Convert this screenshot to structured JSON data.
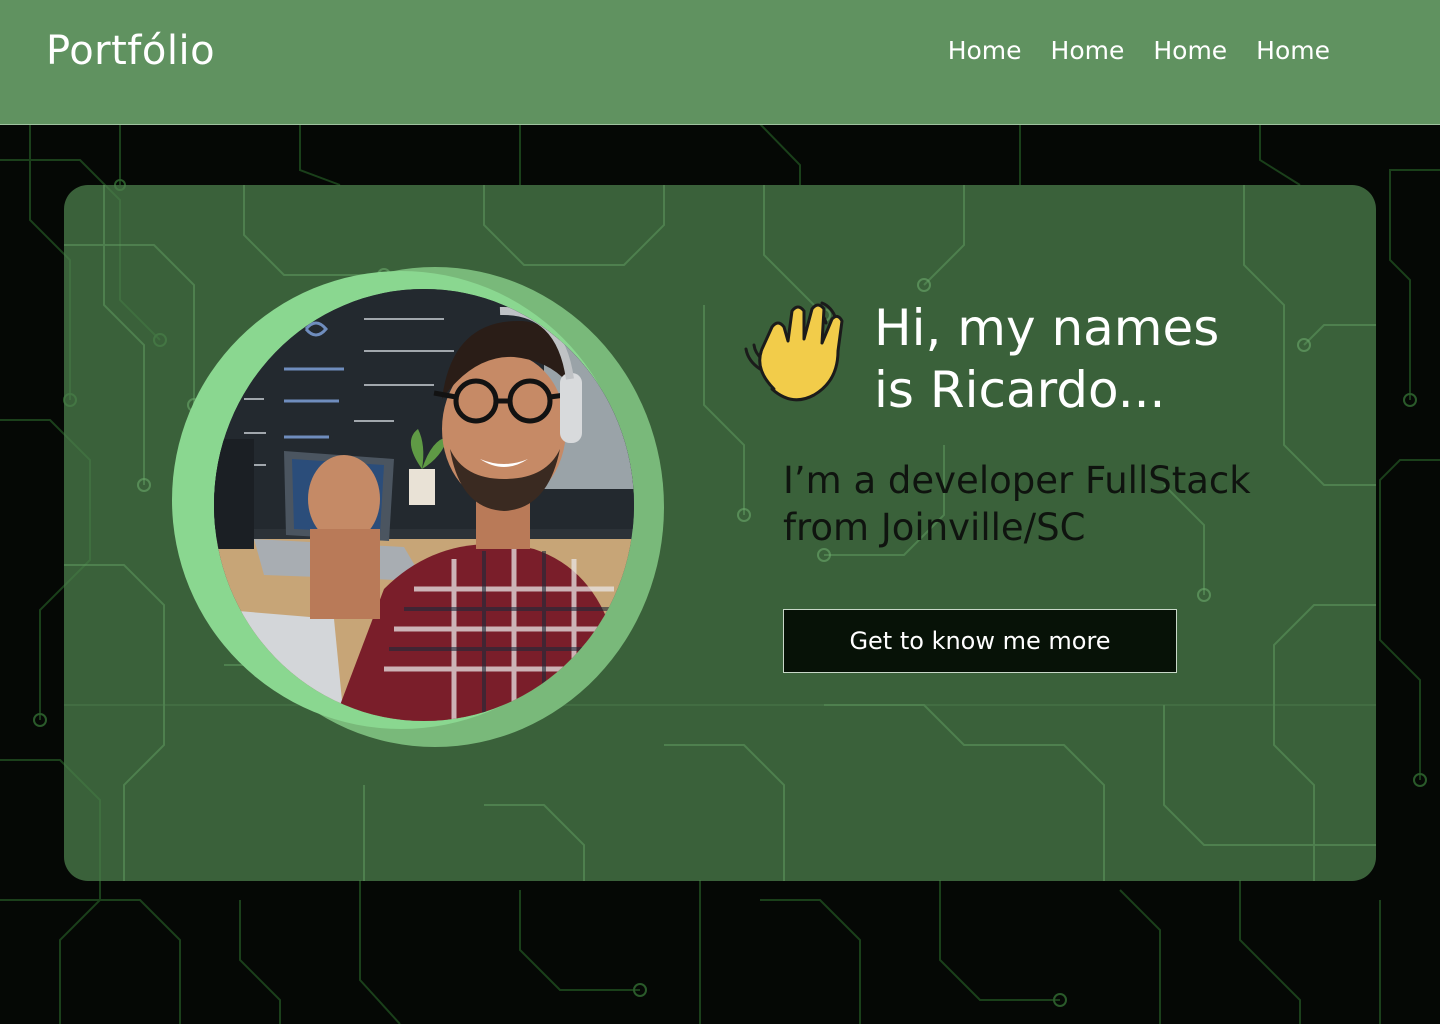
{
  "header": {
    "brand": "Portfólio",
    "nav": [
      {
        "label": "Home"
      },
      {
        "label": "Home"
      },
      {
        "label": "Home"
      },
      {
        "label": "Home"
      }
    ]
  },
  "hero": {
    "greeting_line1": "Hi, my names",
    "greeting_line2": "is Ricardo...",
    "wave_icon": "waving-hand-icon",
    "subtitle_line1": "I’m a developer FullStack",
    "subtitle_line2": "from Joinville/SC",
    "cta_label": "Get to know me more",
    "photo_icon": "developer-portrait-photo"
  },
  "colors": {
    "navbar": "#689e68",
    "card": "#4d804d",
    "ring_light": "#8ad790",
    "ring_dark": "#79b97a",
    "page_background": "#050805",
    "button_background": "#071207"
  }
}
